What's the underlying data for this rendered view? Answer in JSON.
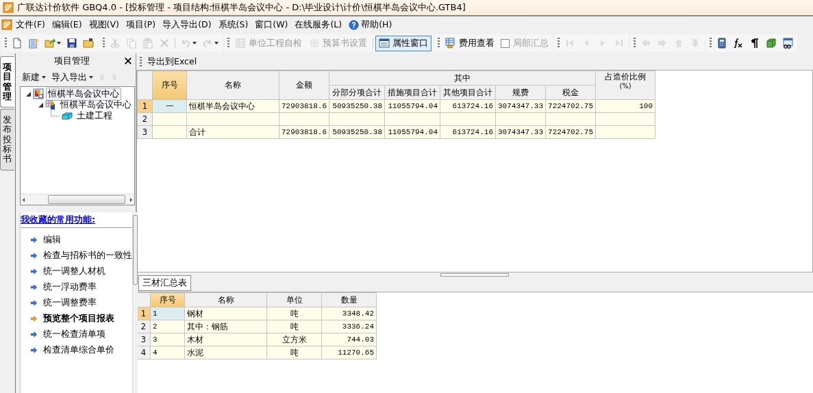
{
  "window": {
    "title": "广联达计价软件 GBQ4.0 - [投标管理 - 项目结构:恒棋半岛会议中心 - D:\\毕业设计\\计价\\恒棋半岛会议中心.GTB4]"
  },
  "menu": [
    {
      "label": "文件(F)",
      "kind": "plain"
    },
    {
      "label": "编辑(E)",
      "kind": "plain"
    },
    {
      "label": "视图(V)",
      "kind": "plain"
    },
    {
      "label": "项目(P)",
      "kind": "plain"
    },
    {
      "label": "导入导出(D)",
      "kind": "plain"
    },
    {
      "label": "系统(S)",
      "kind": "plain"
    },
    {
      "label": "窗口(W)",
      "kind": "plain"
    },
    {
      "label": "在线服务(L)",
      "kind": "plain"
    },
    {
      "label": "帮助(H)",
      "kind": "help"
    }
  ],
  "toolbar": [
    [
      {
        "kind": "new-document",
        "disabled": false
      },
      {
        "kind": "new-project",
        "disabled": false
      },
      {
        "kind": "open",
        "disabled": false,
        "dropdown": true
      },
      {
        "kind": "save",
        "disabled": false
      },
      {
        "kind": "folder",
        "disabled": false
      }
    ],
    [
      {
        "kind": "cut",
        "disabled": true
      },
      {
        "kind": "copy",
        "disabled": true
      },
      {
        "kind": "paste",
        "disabled": true
      },
      {
        "kind": "delete",
        "disabled": true
      },
      {
        "kind": "undo",
        "disabled": true,
        "dropdown": true
      },
      {
        "kind": "redo",
        "disabled": true,
        "dropdown": true
      }
    ],
    [
      {
        "kind": "check-button",
        "label": "单位工程自检",
        "disabled": true,
        "pressed": false
      },
      {
        "kind": "settings-button",
        "label": "预算书设置",
        "disabled": true,
        "pressed": false
      },
      {
        "kind": "window-button",
        "label": "属性窗口",
        "disabled": false,
        "pressed": true
      }
    ],
    [
      {
        "kind": "fee-button",
        "label": "费用查看",
        "disabled": false,
        "pressed": false
      },
      {
        "kind": "checkbox",
        "label": "局部汇总",
        "disabled": true,
        "checked": false
      }
    ],
    [
      {
        "kind": "first",
        "disabled": true
      },
      {
        "kind": "prev",
        "disabled": true
      },
      {
        "kind": "next",
        "disabled": true
      },
      {
        "kind": "last",
        "disabled": true
      }
    ],
    [
      {
        "kind": "left",
        "disabled": true
      },
      {
        "kind": "right",
        "disabled": true
      },
      {
        "kind": "up",
        "disabled": true
      },
      {
        "kind": "down",
        "disabled": true
      }
    ],
    [
      {
        "kind": "calculator",
        "disabled": false
      },
      {
        "kind": "formula",
        "disabled": false
      },
      {
        "kind": "pilcrow",
        "disabled": false
      },
      {
        "kind": "cube",
        "disabled": false
      },
      {
        "kind": "preview",
        "disabled": false
      }
    ]
  ],
  "side_tabs": [
    {
      "label": "项目管理",
      "selected": true
    },
    {
      "label": "发布投标书",
      "selected": false
    }
  ],
  "project_panel": {
    "title": "项目管理",
    "toolbar": [
      {
        "label": "新建",
        "kind": "menu",
        "disabled": false
      },
      {
        "label": "导入导出",
        "kind": "menu",
        "disabled": false
      },
      {
        "kind": "up",
        "disabled": true
      },
      {
        "kind": "down",
        "disabled": true
      }
    ],
    "tree": [
      {
        "label": "恒棋半岛会议中心",
        "kind": "project",
        "selected": true,
        "expanded": true,
        "children": [
          {
            "label": "恒棋半岛会议中心",
            "kind": "single",
            "selected": false,
            "expanded": true,
            "children": [
              {
                "label": "土建工程",
                "kind": "unit",
                "selected": false
              }
            ]
          }
        ]
      }
    ]
  },
  "favorites": {
    "title": "我收藏的常用功能:",
    "items": [
      {
        "label": "编辑",
        "highlighted": false
      },
      {
        "label": "检查与招标书的一致性",
        "highlighted": false
      },
      {
        "label": "统一调整人材机",
        "highlighted": false
      },
      {
        "label": "统一浮动费率",
        "highlighted": false
      },
      {
        "label": "统一调整费率",
        "highlighted": false
      },
      {
        "label": "预览整个项目报表",
        "highlighted": true
      },
      {
        "label": "统一检查清单项",
        "highlighted": false
      },
      {
        "label": "检查清单综合单价",
        "highlighted": false
      }
    ]
  },
  "main_toolbar": [
    {
      "label": "导出到Excel"
    }
  ],
  "summary_table": {
    "columns": [
      {
        "label": "序号",
        "kind": "index",
        "selected": true
      },
      {
        "label": "名称",
        "kind": "text",
        "selected": false
      },
      {
        "label": "金额",
        "kind": "amount",
        "selected": false
      },
      {
        "label": "其中",
        "kind": "group",
        "selected": false,
        "children": [
          {
            "label": "分部分项合计",
            "kind": "number",
            "selected": false
          },
          {
            "label": "措施项目合计",
            "kind": "number",
            "selected": false
          },
          {
            "label": "其他项目合计",
            "kind": "number",
            "selected": false
          },
          {
            "label": "规费",
            "kind": "number",
            "selected": false
          },
          {
            "label": "税金",
            "kind": "number",
            "selected": false
          }
        ]
      },
      {
        "label": "占造价比例",
        "unit": "(%)",
        "kind": "number",
        "selected": false
      }
    ],
    "rows": [
      {
        "number": "1",
        "selected": true,
        "cells": [
          "一",
          "恒棋半岛会议中心",
          "72903818.6",
          "50935250.38",
          "11055794.04",
          "613724.16",
          "3074347.33",
          "7224702.75",
          "100"
        ]
      },
      {
        "number": "2",
        "selected": false
      },
      {
        "number": "3",
        "selected": false,
        "cells": [
          null,
          "合计",
          "72903818.6",
          "50935250.38",
          "11055794.04",
          "613724.16",
          "3074347.33",
          "7224702.75",
          null
        ]
      }
    ]
  },
  "bottom_tabs": [
    {
      "label": "三材汇总表",
      "selected": true
    }
  ],
  "materials_table": {
    "columns": [
      {
        "label": "序号",
        "kind": "code",
        "selected": true
      },
      {
        "label": "名称",
        "kind": "text",
        "selected": false
      },
      {
        "label": "单位",
        "kind": "unit",
        "selected": false
      },
      {
        "label": "数量",
        "kind": "number",
        "selected": false
      }
    ],
    "rows": [
      {
        "number": "1",
        "selected": true,
        "cells": [
          "1",
          "钢材",
          "吨",
          "3348.42"
        ]
      },
      {
        "number": "2",
        "selected": false,
        "cells": [
          "2",
          "其中：钢筋",
          "吨",
          "3336.24"
        ]
      },
      {
        "number": "3",
        "selected": false,
        "cells": [
          "3",
          "木材",
          "立方米",
          "744.03"
        ]
      },
      {
        "number": "4",
        "selected": false,
        "cells": [
          "4",
          "水泥",
          "吨",
          "11270.65"
        ]
      }
    ]
  }
}
